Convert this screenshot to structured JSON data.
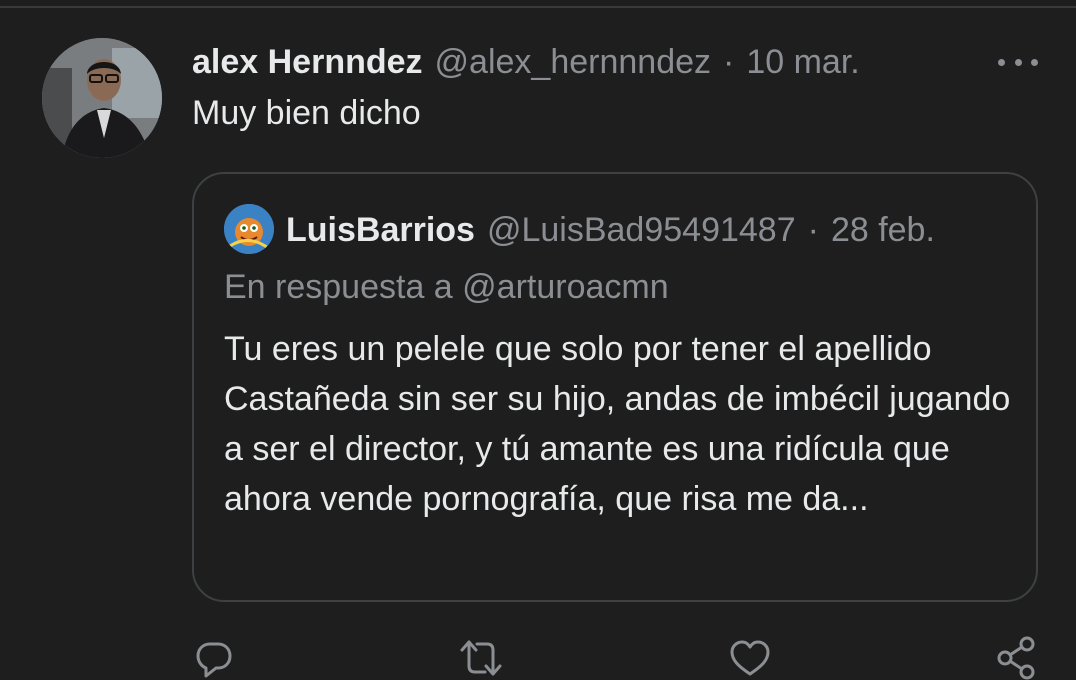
{
  "tweet": {
    "author_name": "alex Hernndez",
    "handle": "@alex_hernnndez",
    "separator": "·",
    "date": "10 mar.",
    "text": "Muy bien dicho"
  },
  "quoted_tweet": {
    "author_name": "LuisBarrios",
    "handle": "@LuisBad95491487",
    "separator": "·",
    "date": "28 feb.",
    "reply_to": "En respuesta a @arturoacmn",
    "text": "Tu eres un pelele que solo por tener el apellido Castañeda sin ser su hijo, andas de imbécil jugando a ser el director, y tú amante es una ridícula que ahora vende pornografía, que risa me da..."
  },
  "actions": {
    "icons": [
      "reply-icon",
      "retweet-icon",
      "like-icon",
      "share-icon"
    ]
  },
  "colors": {
    "background": "#1e1e1e",
    "primary_text": "#e7e9ea",
    "secondary_text": "#8b8f93",
    "border": "#3d4144"
  }
}
